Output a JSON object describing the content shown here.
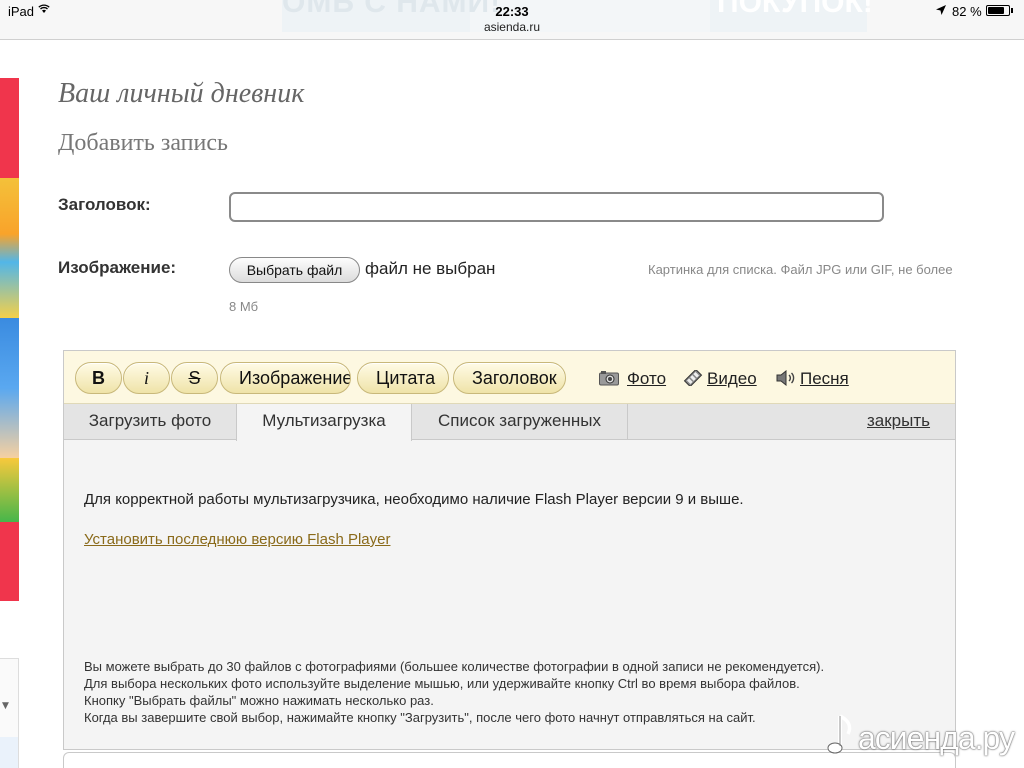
{
  "status_bar": {
    "device": "iPad",
    "time": "22:33",
    "url": "asienda.ru",
    "battery": "82 %",
    "battery_level": 0.82
  },
  "banner": {
    "left_text": "ОМЬ С НАМИ!",
    "right_text": "ПОКУПОК!"
  },
  "page": {
    "title": "Ваш личный дневник",
    "section": "Добавить запись"
  },
  "form": {
    "title_label": "Заголовок:",
    "title_value": "",
    "image_label": "Изображение:",
    "choose_file": "Выбрать файл",
    "file_status": "файл не выбран",
    "file_hint_line1": "Картинка для списка. Файл JPG или GIF, не более",
    "file_hint_line2": "8 Мб"
  },
  "toolbar": {
    "bold": "B",
    "italic": "i",
    "strike": "S",
    "image": "Изображение",
    "quote": "Цитата",
    "heading": "Заголовок",
    "photo": "Фото",
    "video": "Видео",
    "song": "Песня"
  },
  "tabs": {
    "upload_photo": "Загрузить фото",
    "multi_upload": "Мультизагрузка",
    "uploaded_list": "Список загруженных",
    "close": "закрыть"
  },
  "panel": {
    "message": "Для корректной работы мультизагрузчика, необходимо наличие Flash Player версии 9 и выше.",
    "flash_link": "Установить последнюю версию Flash Player",
    "help": [
      "Вы можете выбрать до 30 файлов с фотографиями (большее количестве фотографии в одной записи не рекомендуется).",
      "Для выбора нескольких фото используйте выделение мышью, или удерживайте кнопку Ctrl во время выбора файлов.",
      "Кнопку \"Выбрать файлы\" можно нажимать несколько раз.",
      "Когда вы завершите свой выбор, нажимайте кнопку \"Загрузить\", после чего фото начнут отправляться на сайт."
    ]
  },
  "watermark": {
    "text": "асиенда.ру"
  }
}
